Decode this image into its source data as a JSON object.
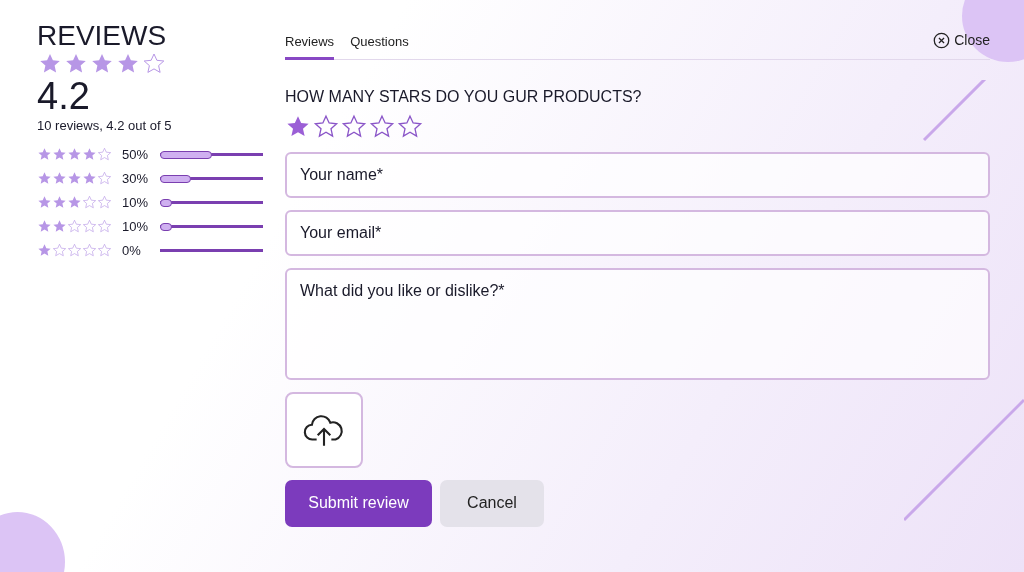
{
  "summary": {
    "title": "REVIEWS",
    "stars": 4,
    "score": "4.2",
    "caption": "10 reviews, 4.2 out of 5"
  },
  "distribution": [
    {
      "stars": 4,
      "percent": "50%",
      "level": 0.5
    },
    {
      "stars": 4,
      "percent": "30%",
      "level": 0.3
    },
    {
      "stars": 3,
      "percent": "10%",
      "level": 0.1
    },
    {
      "stars": 2,
      "percent": "10%",
      "level": 0.1
    },
    {
      "stars": 1,
      "percent": "0%"
    }
  ],
  "tabs": [
    {
      "label": "Reviews",
      "selected": true
    },
    {
      "label": "Questions",
      "selected": false
    }
  ],
  "close": {
    "label": "Close"
  },
  "question": "HOW MANY STARS DO YOU GUR PRODUCTS?",
  "rating": {
    "stars": 1
  },
  "fields": [
    {
      "kind": "input",
      "placeholder": "Your name*"
    },
    {
      "kind": "input",
      "placeholder": "Your email*"
    },
    {
      "kind": "textarea",
      "placeholder": "What did you like or dislike?*"
    }
  ],
  "buttons": [
    {
      "label": "Submit review",
      "kind": "primary"
    },
    {
      "label": "Cancel",
      "kind": "secondary"
    }
  ]
}
